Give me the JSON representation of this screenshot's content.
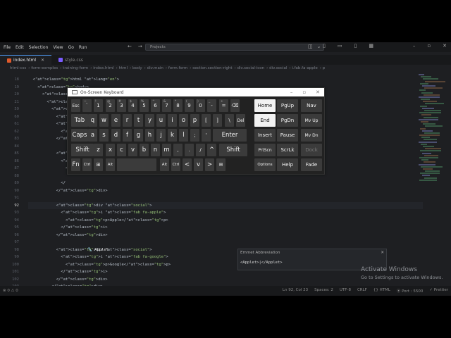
{
  "menu": [
    "File",
    "Edit",
    "Selection",
    "View",
    "Go",
    "Run"
  ],
  "command_center": {
    "placeholder": "Projects"
  },
  "tabs": [
    {
      "label": "index.html",
      "color": "#e05a2b",
      "active": true
    },
    {
      "label": "style.css",
      "color": "#7a5cff",
      "active": false
    }
  ],
  "breadcrumb": [
    "html-css",
    "form-exmples",
    "training-form",
    "index.html",
    "html",
    "body",
    "div.main",
    "form.form",
    "section.section-right",
    "div.social-icon",
    "div.social",
    "i.fab.fa-apple",
    "p"
  ],
  "lines": [
    {
      "n": "18",
      "text": "  <html lang=\"en\">"
    },
    {
      "n": "19",
      "text": "    <body>"
    },
    {
      "n": "20",
      "text": "      <div class=\""
    },
    {
      "n": "21",
      "text": "        <form acti"
    },
    {
      "n": "59",
      "text": "          <sectio"
    },
    {
      "n": "60",
      "text": "            <hr>"
    },
    {
      "n": "61",
      "text": "            <div c"
    },
    {
      "n": "62",
      "text": "              <p c"
    },
    {
      "n": "83",
      "text": "            </div>"
    },
    {
      "n": "84",
      "text": ""
    },
    {
      "n": "85",
      "text": "            <div c"
    },
    {
      "n": "86",
      "text": "              <div"
    },
    {
      "n": "87",
      "text": "                <"
    },
    {
      "n": "88",
      "text": ""
    },
    {
      "n": "89",
      "text": "              </"
    },
    {
      "n": "90",
      "text": "            </div>"
    },
    {
      "n": "91",
      "text": ""
    },
    {
      "n": "92",
      "text": "            <div class=\"social\">"
    },
    {
      "n": "93",
      "text": "              <i class=\"fab fa-apple\">"
    },
    {
      "n": "94",
      "text": "                <p>Apple</p>"
    },
    {
      "n": "95",
      "text": "              </i>"
    },
    {
      "n": "96",
      "text": "            </div>"
    },
    {
      "n": "97",
      "text": ""
    },
    {
      "n": "98",
      "text": "            <div class=\"social\">"
    },
    {
      "n": "99",
      "text": "              <i class=\"fab fa-google\">"
    },
    {
      "n": "100",
      "text": "                <p>Google</p>"
    },
    {
      "n": "101",
      "text": "              </i>"
    },
    {
      "n": "102",
      "text": "            </div>"
    },
    {
      "n": "103",
      "text": "          </div>"
    },
    {
      "n": "104",
      "text": "        </section>"
    },
    {
      "n": "105",
      "text": "      </form>"
    },
    {
      "n": "106",
      "text": "    </div>"
    }
  ],
  "suggestion": {
    "label": "Applet"
  },
  "emmet": {
    "title": "Emmet Abbreviation",
    "close": "✕",
    "preview": "<Applet>|</Applet>"
  },
  "status": {
    "left": "⊗ 0 ⚠ 0",
    "right": [
      "Ln 92, Col 23",
      "Spaces: 2",
      "UTF-8",
      "CRLF",
      "{} HTML",
      "⦿ Port : 5500",
      "✓ Prettier"
    ]
  },
  "activate": {
    "title": "Activate Windows",
    "subtitle": "Go to Settings to activate Windows."
  },
  "osk": {
    "title": "On-Screen Keyboard",
    "keys": {
      "esc": "Esc",
      "grave": "`",
      "n1": "1",
      "n2": "2",
      "n3": "3",
      "n4": "4",
      "n5": "5",
      "n6": "6",
      "n7": "7",
      "n8": "8",
      "n9": "9",
      "n0": "0",
      "minus": "-",
      "equals": "=",
      "backspace": "⌫",
      "tab": "Tab",
      "q": "q",
      "w": "w",
      "e": "e",
      "r": "r",
      "t": "t",
      "y": "y",
      "u": "u",
      "i": "i",
      "o": "o",
      "p": "p",
      "lbr": "[",
      "rbr": "]",
      "bsl": "\\",
      "del": "Del",
      "caps": "Caps",
      "a": "a",
      "s": "s",
      "d": "d",
      "f": "f",
      "g": "g",
      "h": "h",
      "j": "j",
      "k": "k",
      "l": "l",
      "semi": ";",
      "quote": "'",
      "enter": "Enter",
      "shift_l": "Shift",
      "z": "z",
      "x": "x",
      "c": "c",
      "v": "v",
      "b": "b",
      "n": "n",
      "m": "m",
      "comma": ",",
      "period": ".",
      "slash": "/",
      "up": "^",
      "shift_r": "Shift",
      "fn": "Fn",
      "ctrl_l": "Ctrl",
      "win": "⊞",
      "alt_l": "Alt",
      "space": "",
      "alt_r": "Alt",
      "ctrl_r": "Ctrl",
      "left": "<",
      "down": "v",
      "right": ">",
      "menu": "▤",
      "home": "Home",
      "pgup": "PgUp",
      "nav": "Nav",
      "end": "End",
      "pgdn": "PgDn",
      "mvup": "Mv Up",
      "insert": "Insert",
      "pause": "Pause",
      "mvdn": "Mv Dn",
      "prtscn": "PrtScn",
      "scrlk": "ScrLk",
      "dock": "Dock",
      "options": "Options",
      "help": "Help",
      "fade": "Fade"
    },
    "shift_labels": {
      "n1": "!",
      "n2": "@",
      "n3": "#",
      "n4": "$",
      "n5": "%",
      "n6": "^",
      "n7": "&",
      "n8": "*",
      "n9": "(",
      "n0": ")",
      "minus": "_",
      "equals": "+",
      "grave": "~"
    }
  }
}
